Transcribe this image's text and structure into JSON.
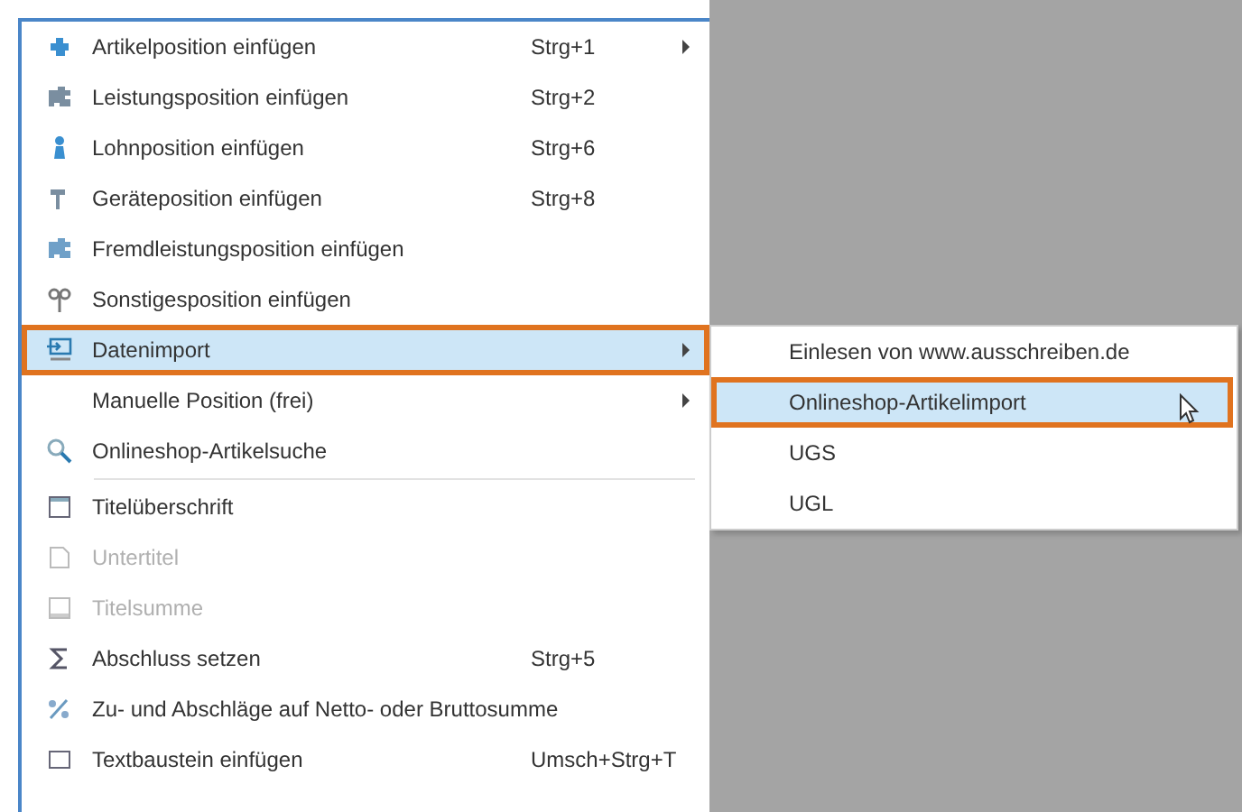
{
  "menu": {
    "items": [
      {
        "kind": "item",
        "label": "Artikelposition einfügen",
        "shortcut": "Strg+1",
        "submenu": true,
        "disabled": false,
        "selected": false,
        "outlined": false
      },
      {
        "kind": "item",
        "label": "Leistungsposition einfügen",
        "shortcut": "Strg+2",
        "submenu": false,
        "disabled": false,
        "selected": false,
        "outlined": false
      },
      {
        "kind": "item",
        "label": "Lohnposition einfügen",
        "shortcut": "Strg+6",
        "submenu": false,
        "disabled": false,
        "selected": false,
        "outlined": false
      },
      {
        "kind": "item",
        "label": "Geräteposition einfügen",
        "shortcut": "Strg+8",
        "submenu": false,
        "disabled": false,
        "selected": false,
        "outlined": false
      },
      {
        "kind": "item",
        "label": "Fremdleistungsposition einfügen",
        "submenu": false,
        "disabled": false,
        "selected": false,
        "outlined": false
      },
      {
        "kind": "item",
        "label": "Sonstigesposition einfügen",
        "submenu": false,
        "disabled": false,
        "selected": false,
        "outlined": false
      },
      {
        "kind": "item",
        "label": "Datenimport",
        "submenu": true,
        "disabled": false,
        "selected": true,
        "outlined": true
      },
      {
        "kind": "item",
        "label": "Manuelle Position (frei)",
        "submenu": true,
        "disabled": false,
        "selected": false,
        "outlined": false
      },
      {
        "kind": "item",
        "label": "Onlineshop-Artikelsuche",
        "submenu": false,
        "disabled": false,
        "selected": false,
        "outlined": false
      },
      {
        "kind": "separator"
      },
      {
        "kind": "item",
        "label": "Titelüberschrift",
        "submenu": false,
        "disabled": false,
        "selected": false,
        "outlined": false
      },
      {
        "kind": "item",
        "label": "Untertitel",
        "submenu": false,
        "disabled": true,
        "selected": false,
        "outlined": false
      },
      {
        "kind": "item",
        "label": "Titelsumme",
        "submenu": false,
        "disabled": true,
        "selected": false,
        "outlined": false
      },
      {
        "kind": "item",
        "label": "Abschluss setzen",
        "shortcut": "Strg+5",
        "submenu": false,
        "disabled": false,
        "selected": false,
        "outlined": false
      },
      {
        "kind": "item",
        "label": "Zu- und Abschläge auf Netto- oder Bruttosumme",
        "submenu": false,
        "disabled": false,
        "selected": false,
        "outlined": false
      },
      {
        "kind": "item",
        "label": "Textbaustein einfügen",
        "shortcut": "Umsch+Strg+T",
        "submenu": false,
        "disabled": false,
        "selected": false,
        "outlined": false
      }
    ]
  },
  "submenu": {
    "items": [
      {
        "label": "Einlesen von www.ausschreiben.de",
        "selected": false,
        "outlined": false
      },
      {
        "label": "Onlineshop-Artikelimport",
        "selected": true,
        "outlined": true
      },
      {
        "label": "UGS",
        "selected": false,
        "outlined": false
      },
      {
        "label": "UGL",
        "selected": false,
        "outlined": false
      }
    ]
  }
}
